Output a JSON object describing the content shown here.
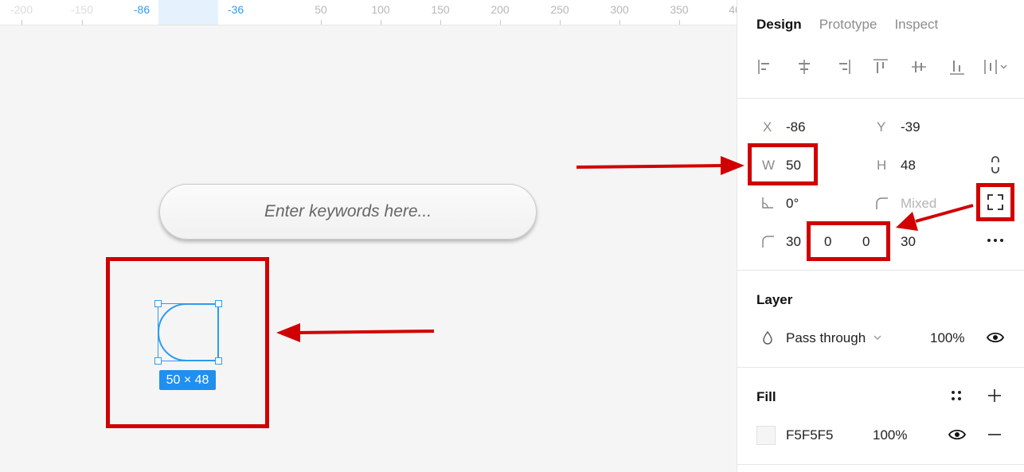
{
  "ruler": {
    "ticks": [
      "-200",
      "-150",
      "-86",
      "-36",
      "50",
      "100",
      "150",
      "200",
      "250",
      "300",
      "350",
      "40"
    ]
  },
  "canvas": {
    "search_placeholder": "Enter keywords here...",
    "size_tag": "50 × 48"
  },
  "panel": {
    "tabs": [
      "Design",
      "Prototype",
      "Inspect"
    ],
    "x_label": "X",
    "x_value": "-86",
    "y_label": "Y",
    "y_value": "-39",
    "w_label": "W",
    "w_value": "50",
    "h_label": "H",
    "h_value": "48",
    "rotation_value": "0°",
    "corner_mixed": "Mixed",
    "radius_tl": "30",
    "radius_tr": "0",
    "radius_br": "0",
    "radius_bl": "30",
    "layer_title": "Layer",
    "blend_mode": "Pass through",
    "layer_opacity": "100%",
    "fill_title": "Fill",
    "fill_hex": "F5F5F5",
    "fill_opacity": "100%"
  },
  "colors": {
    "selection": "#2c9cf0",
    "annotation_red": "#d10000",
    "canvas_bg": "#f5f5f5"
  }
}
